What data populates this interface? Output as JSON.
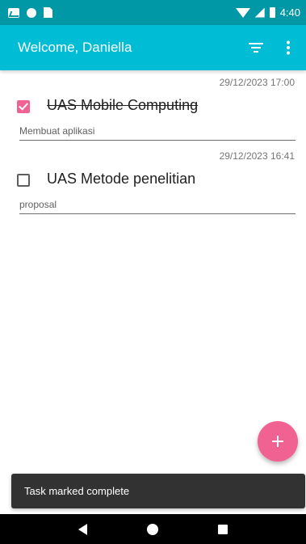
{
  "status_bar": {
    "time": "4:40",
    "icons": [
      "activity-icon",
      "circle-icon",
      "sd-card-icon",
      "wifi-icon",
      "signal-icon",
      "battery-icon"
    ]
  },
  "app_bar": {
    "title": "Welcome, Daniella",
    "actions": [
      "filter-icon",
      "overflow-menu-icon"
    ]
  },
  "tasks": [
    {
      "date": "29/12/2023 17:00",
      "title": "UAS Mobile Computing",
      "description": "Membuat aplikasi",
      "completed": true
    },
    {
      "date": "29/12/2023 16:41",
      "title": "UAS Metode penelitian",
      "description": "proposal",
      "completed": false
    }
  ],
  "fab": {
    "icon": "add-icon"
  },
  "snackbar": {
    "message": "Task marked complete"
  },
  "nav_bar": {
    "icons": [
      "back-icon",
      "home-icon",
      "recents-icon"
    ]
  },
  "colors": {
    "status_bar": "#0097a7",
    "primary": "#00bcd4",
    "accent": "#f06292",
    "snackbar": "#323232"
  }
}
